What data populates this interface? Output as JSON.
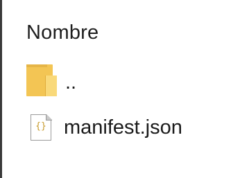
{
  "column_header": "Nombre",
  "items": [
    {
      "name": "..",
      "icon": "folder-icon"
    },
    {
      "name": "manifest.json",
      "icon": "json-file-icon",
      "icon_glyph": "{}"
    }
  ],
  "colors": {
    "folder": "#f3c554",
    "folder_front": "#f9d97a",
    "json_glyph": "#c79a2a",
    "left_border": "#3a3a3a"
  }
}
